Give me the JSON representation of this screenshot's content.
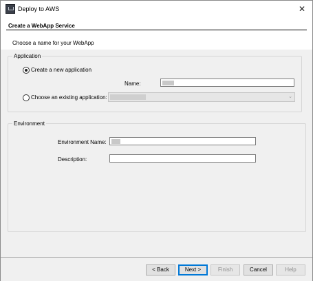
{
  "window": {
    "title": "Deploy to AWS",
    "close_glyph": "✕"
  },
  "header": {
    "title": "Create a WebApp Service",
    "subtitle": "Choose a name for your WebApp"
  },
  "application": {
    "legend": "Application",
    "create_new_label": "Create a new application",
    "name_label": "Name:",
    "name_value": "",
    "choose_existing_label": "Choose an existing application:",
    "existing_value": ""
  },
  "environment": {
    "legend": "Environment",
    "env_name_label": "Environment Name:",
    "env_name_value": "",
    "description_label": "Description:",
    "description_value": ""
  },
  "footer": {
    "back_label": "< Back",
    "next_label": "Next >",
    "finish_label": "Finish",
    "cancel_label": "Cancel",
    "help_label": "Help"
  },
  "colors": {
    "accent": "#0078d7",
    "panel": "#f0f0f0",
    "group_border": "#d5d5d5"
  },
  "icons": [
    "app-icon",
    "close-icon",
    "chevron-down-icon"
  ]
}
